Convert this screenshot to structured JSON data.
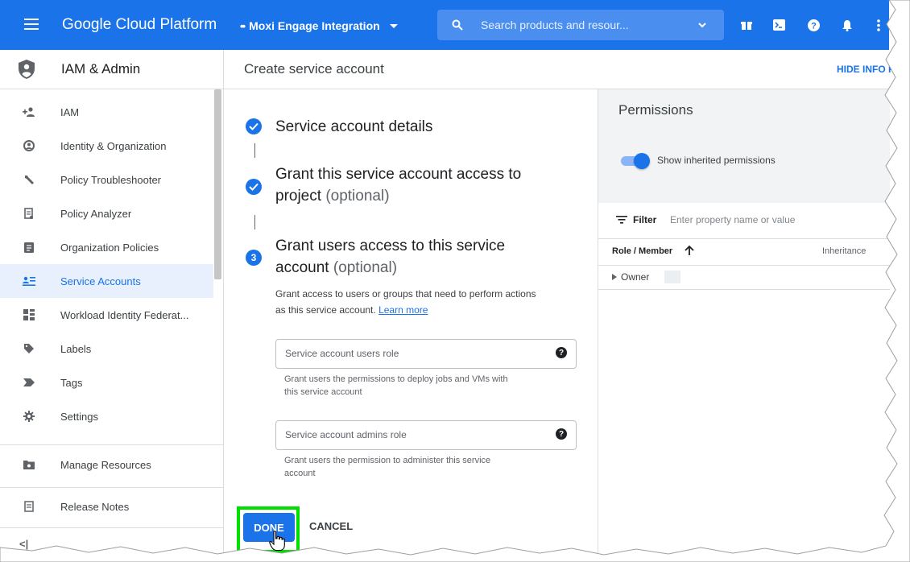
{
  "topbar": {
    "brand": "Google Cloud Platform",
    "project": "Moxi Engage Integration",
    "search_placeholder": "Search products and resour..."
  },
  "header": {
    "section_title": "IAM & Admin",
    "page_title": "Create service account",
    "hide_info_label": "HIDE INFO PA"
  },
  "sidebar": {
    "items": [
      {
        "label": "IAM",
        "icon": "person-add-icon"
      },
      {
        "label": "Identity & Organization",
        "icon": "account-circle-icon"
      },
      {
        "label": "Policy Troubleshooter",
        "icon": "wrench-icon"
      },
      {
        "label": "Policy Analyzer",
        "icon": "document-search-icon"
      },
      {
        "label": "Organization Policies",
        "icon": "list-document-icon"
      },
      {
        "label": "Service Accounts",
        "icon": "service-account-icon",
        "active": true
      },
      {
        "label": "Workload Identity Federat...",
        "icon": "workload-identity-icon"
      },
      {
        "label": "Labels",
        "icon": "label-icon"
      },
      {
        "label": "Tags",
        "icon": "tag-icon"
      },
      {
        "label": "Settings",
        "icon": "gear-icon"
      },
      {
        "label": "Manage Resources",
        "icon": "folder-gear-icon"
      },
      {
        "label": "Release Notes",
        "icon": "release-notes-icon"
      }
    ],
    "collapse_label": "<|"
  },
  "form": {
    "step1_title": "Service account details",
    "step2_title": "Grant this service account access to",
    "step2_title_line2": "project",
    "step2_optional": "(optional)",
    "step3_number": "3",
    "step3_title": "Grant users access to this service",
    "step3_title_line2": "account",
    "step3_optional": "(optional)",
    "step3_desc_line1": "Grant access to users or groups that need to perform actions",
    "step3_desc_line2": "as this service account.",
    "learn_more": "Learn more",
    "users_role_placeholder": "Service account users role",
    "users_role_hint_line1": "Grant users the permissions to deploy jobs and VMs with",
    "users_role_hint_line2": "this service account",
    "admins_role_placeholder": "Service account admins role",
    "admins_role_hint_line1": "Grant users the permission to administer this service",
    "admins_role_hint_line2": "account",
    "done_label": "DONE",
    "cancel_label": "CANCEL"
  },
  "permissions": {
    "title": "Permissions",
    "toggle_label": "Show inherited permissions",
    "toggle_on": true,
    "filter_label": "Filter",
    "filter_placeholder": "Enter property name or value",
    "col_role": "Role / Member",
    "col_inheritance": "Inheritance",
    "rows": [
      {
        "label": "Owner"
      }
    ]
  },
  "colors": {
    "accent": "#1a73e8",
    "highlight": "#00e000"
  }
}
